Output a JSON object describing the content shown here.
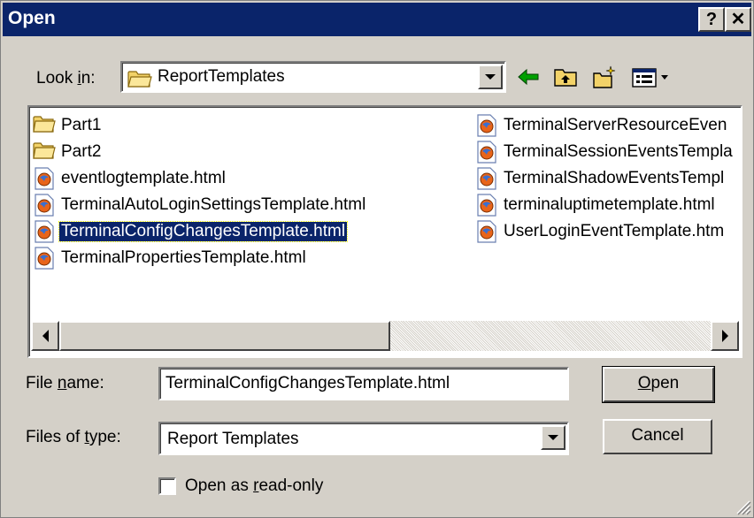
{
  "window": {
    "title": "Open",
    "help_label": "?",
    "close_label": "✕"
  },
  "look_in": {
    "label_pre": "Look ",
    "label_key": "i",
    "label_post": "n:",
    "value": "ReportTemplates"
  },
  "files": [
    {
      "name": "Part1",
      "type": "folder",
      "selected": false
    },
    {
      "name": "Part2",
      "type": "folder",
      "selected": false
    },
    {
      "name": "eventlogtemplate.html",
      "type": "html",
      "selected": false
    },
    {
      "name": "TerminalAutoLoginSettingsTemplate.html",
      "type": "html",
      "selected": false
    },
    {
      "name": "TerminalConfigChangesTemplate.html",
      "type": "html",
      "selected": true
    },
    {
      "name": "TerminalPropertiesTemplate.html",
      "type": "html",
      "selected": false
    },
    {
      "name": "TerminalServerResourceEven",
      "type": "html",
      "selected": false
    },
    {
      "name": "TerminalSessionEventsTempla",
      "type": "html",
      "selected": false
    },
    {
      "name": "TerminalShadowEventsTempl",
      "type": "html",
      "selected": false
    },
    {
      "name": "terminaluptimetemplate.html",
      "type": "html",
      "selected": false
    },
    {
      "name": "UserLoginEventTemplate.htm",
      "type": "html",
      "selected": false
    }
  ],
  "file_name": {
    "label_pre": "File ",
    "label_key": "n",
    "label_post": "ame:",
    "value": "TerminalConfigChangesTemplate.html"
  },
  "files_of_type": {
    "label_pre": "Files of ",
    "label_key": "t",
    "label_post": "ype:",
    "value": "Report Templates"
  },
  "buttons": {
    "open_key": "O",
    "open_rest": "pen",
    "cancel": "Cancel"
  },
  "read_only": {
    "label_pre": "Open as ",
    "label_key": "r",
    "label_post": "ead-only",
    "checked": false
  },
  "colors": {
    "titlebar": "#0a246a",
    "face": "#d4d0c8",
    "selection": "#0a246a"
  }
}
